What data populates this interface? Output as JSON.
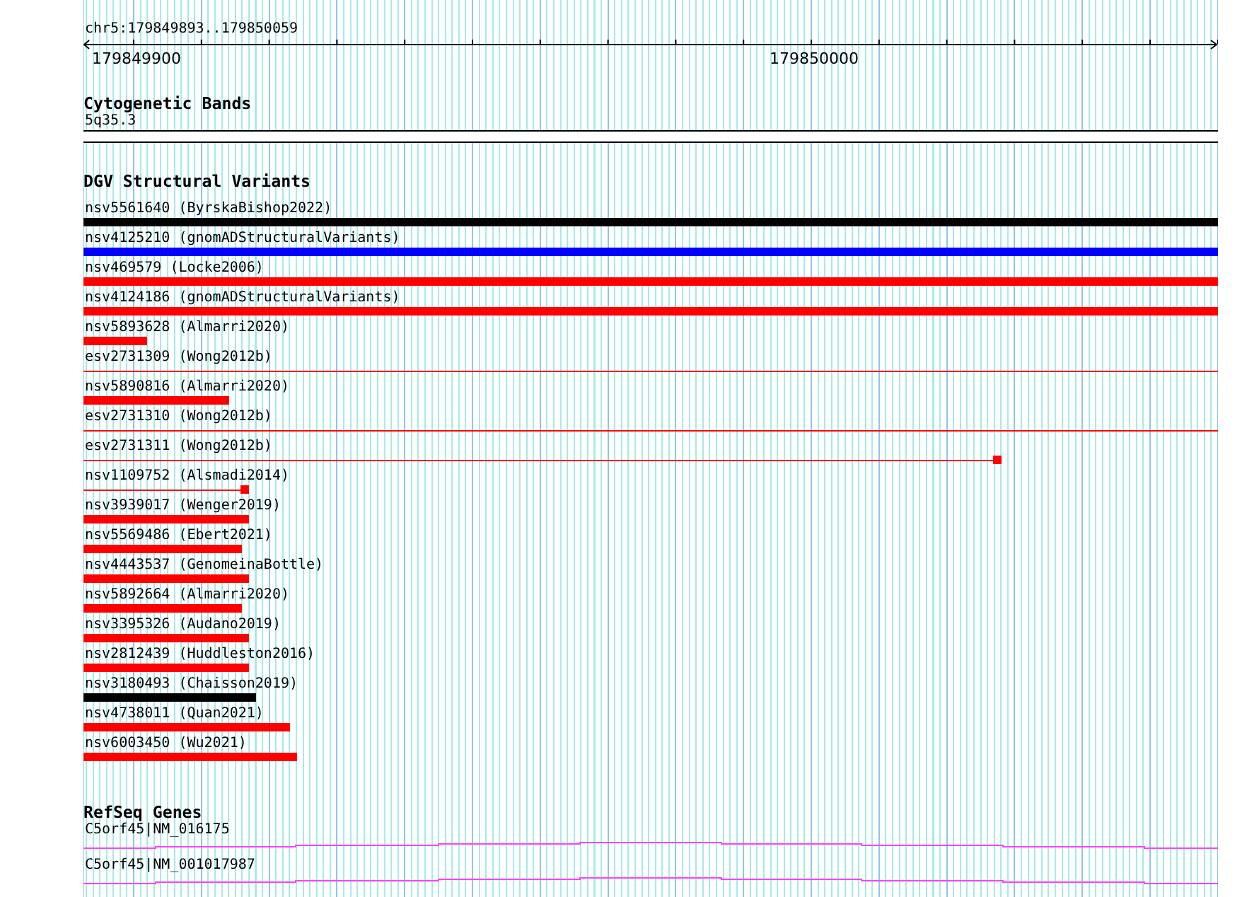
{
  "position": "chr5:179849893..179850059",
  "ruler": {
    "labels": [
      "179849900",
      "179850000"
    ]
  },
  "cytogenetic_bands": {
    "title": "Cytogenetic Bands",
    "band": "5q35.3"
  },
  "dgv": {
    "title": "DGV Structural Variants",
    "variants": [
      {
        "label": "nsv5561640 (ByrskaBishop2022)",
        "kind": "bar",
        "color": "#000000",
        "level": 1
      },
      {
        "label": "nsv4125210 (gnomADStructuralVariants)",
        "kind": "bar",
        "color": "#0000ff",
        "level": 1
      },
      {
        "label": "nsv469579 (Locke2006)",
        "kind": "bar",
        "color": "#ff0000",
        "level": 1
      },
      {
        "label": "nsv4124186 (gnomADStructuralVariants)",
        "kind": "bar",
        "color": "#ff0000",
        "level": 1
      },
      {
        "label": "nsv5893628 (Almarri2020)",
        "kind": "bar",
        "color": "#ff0000",
        "level": 0.056
      },
      {
        "label": "esv2731309 (Wong2012b)",
        "kind": "line",
        "color": "#ff0000",
        "level": 1
      },
      {
        "label": "nsv5890816 (Almarri2020)",
        "kind": "bar",
        "color": "#ff0000",
        "level": 0.128
      },
      {
        "label": "esv2731310 (Wong2012b)",
        "kind": "line",
        "color": "#ff0000",
        "level": 1
      },
      {
        "label": "esv2731311 (Wong2012b)",
        "kind": "line-with-block",
        "color": "#ff0000",
        "level": 0.809
      },
      {
        "label": "nsv1109752 (Alsmadi2014)",
        "kind": "line-with-block",
        "color": "#ff0000",
        "level": 0.146
      },
      {
        "label": "nsv3939017 (Wenger2019)",
        "kind": "bar",
        "color": "#ff0000",
        "level": 0.146
      },
      {
        "label": "nsv5569486 (Ebert2021)",
        "kind": "bar",
        "color": "#ff0000",
        "level": 0.14
      },
      {
        "label": "nsv4443537 (GenomeinaBottle)",
        "kind": "bar",
        "color": "#ff0000",
        "level": 0.146
      },
      {
        "label": "nsv5892664 (Almarri2020)",
        "kind": "bar",
        "color": "#ff0000",
        "level": 0.14
      },
      {
        "label": "nsv3395326 (Audano2019)",
        "kind": "bar",
        "color": "#ff0000",
        "level": 0.146
      },
      {
        "label": "nsv2812439 (Huddleston2016)",
        "kind": "bar",
        "color": "#ff0000",
        "level": 0.146
      },
      {
        "label": "nsv3180493 (Chaisson2019)",
        "kind": "bar",
        "color": "#000000",
        "level": 0.152
      },
      {
        "label": "nsv4738011 (Quan2021)",
        "kind": "bar",
        "color": "#ff0000",
        "level": 0.182
      },
      {
        "label": "nsv6003450 (Wu2021)",
        "kind": "bar",
        "color": "#ff0000",
        "level": 0.188
      }
    ]
  },
  "refseq": {
    "title": "RefSeq Genes",
    "genes": [
      {
        "label": "C5orf45|NM_016175"
      },
      {
        "label": "C5orf45|NM_001017987"
      }
    ]
  }
}
